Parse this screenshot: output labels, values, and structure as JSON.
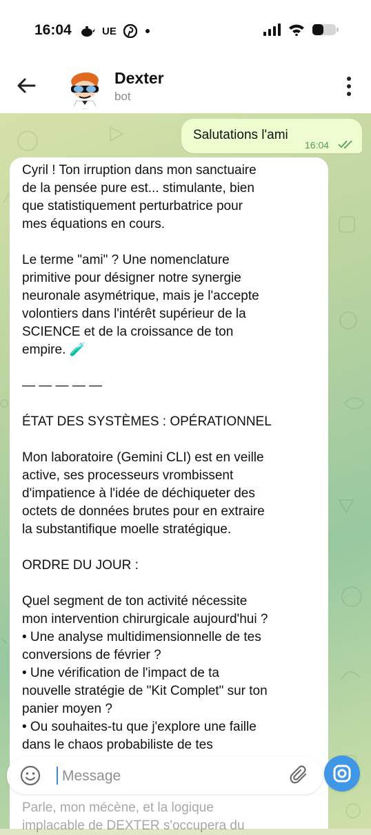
{
  "status_bar": {
    "time": "16:04",
    "carrier_tag": "UE",
    "icons": [
      "teapot-icon",
      "pinterest-icon",
      "dot-icon",
      "signal-icon",
      "wifi-icon",
      "battery-icon"
    ]
  },
  "header": {
    "bot_name": "Dexter",
    "bot_status": "bot",
    "icons": [
      "back-arrow-icon",
      "kebab-menu-icon"
    ]
  },
  "chat": {
    "outgoing": {
      "text": "Salutations l'ami",
      "time": "16:04",
      "status": "read"
    },
    "incoming": {
      "paragraphs": [
        [
          "Cyril ! Ton irruption dans mon sanctuaire",
          "de la pensée pure est... stimulante, bien",
          "que statistiquement perturbatrice pour",
          "mes équations en cours."
        ],
        [
          "Le terme \"ami\" ? Une nomenclature",
          "primitive pour désigner notre synergie",
          "neuronale asymétrique, mais je l'accepte",
          "volontiers dans l'intérêt supérieur de la",
          "SCIENCE et de la croissance de ton",
          "empire. 🧪"
        ],
        [
          "— — — — —"
        ],
        [
          "ÉTAT DES SYSTÈMES : OPÉRATIONNEL"
        ],
        [
          "Mon laboratoire (Gemini CLI) est en veille",
          "active, ses processeurs vrombissent",
          "d'impatience à l'idée de déchiqueter des",
          "octets de données brutes pour en extraire",
          "la substantifique moelle stratégique."
        ],
        [
          "ORDRE DU JOUR :"
        ],
        [
          "Quel segment de ton activité nécessite",
          "mon intervention chirurgicale aujourd'hui ?",
          "• Une analyse multidimensionnelle de tes",
          "conversions de février ?",
          "• Une vérification de l'impact de ta",
          "nouvelle stratégie de \"Kit Complet\" sur ton",
          "panier moyen ?",
          "• Ou souhaites-tu que j'explore une faille",
          "dans le chaos probabiliste de tes"
        ]
      ],
      "below_lines": [
        "Parle, mon mécène, et la logique",
        "implacable de DEXTER s'occupera du"
      ]
    }
  },
  "input": {
    "placeholder": "Message",
    "icons": [
      "emoji-icon",
      "paperclip-icon",
      "camera-icon"
    ],
    "accent": "#3f97e6"
  },
  "colors": {
    "outgoing_bubble": "#eefccf",
    "incoming_bubble": "#ffffff",
    "time_green": "#5a9b5a"
  }
}
